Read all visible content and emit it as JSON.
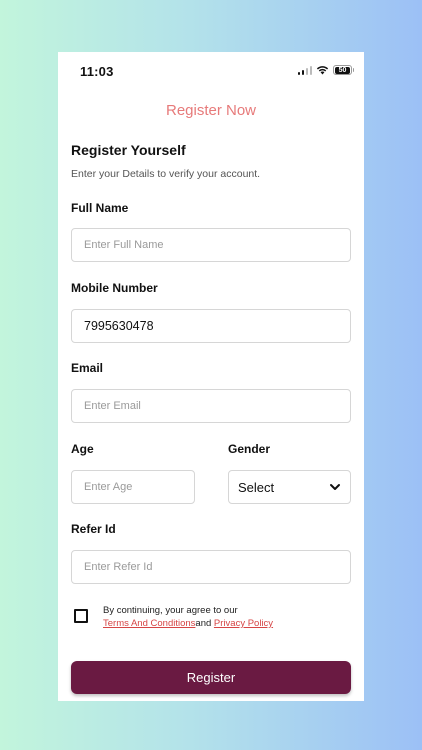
{
  "status_bar": {
    "time": "11:03",
    "battery": "50"
  },
  "header": {
    "title": "Register Now"
  },
  "intro": {
    "title": "Register Yourself",
    "subtitle": "Enter your Details to verify your account."
  },
  "form": {
    "full_name": {
      "label": "Full Name",
      "placeholder": "Enter Full Name"
    },
    "mobile": {
      "label": "Mobile Number",
      "value": "7995630478"
    },
    "email": {
      "label": "Email",
      "placeholder": "Enter Email"
    },
    "age": {
      "label": "Age",
      "placeholder": "Enter Age"
    },
    "gender": {
      "label": "Gender",
      "value": "Select"
    },
    "refer": {
      "label": "Refer Id",
      "placeholder": "Enter Refer Id"
    }
  },
  "consent": {
    "text": "By continuing, your agree to our",
    "terms": "Terms And Conditions",
    "and": "and",
    "privacy": "Privacy Policy",
    "checked": false
  },
  "register_button": "Register",
  "colors": {
    "title": "#e77a7a",
    "button": "#6a1a42",
    "link": "#d64545"
  }
}
